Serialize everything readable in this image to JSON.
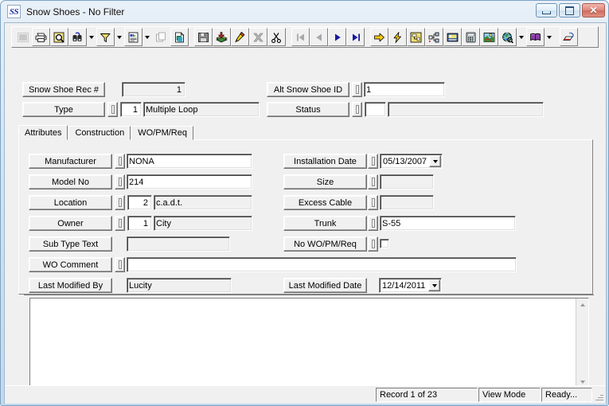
{
  "window": {
    "title": "Snow Shoes - No Filter",
    "app_icon_text": "SS",
    "minimize_label": "",
    "maximize_label": "",
    "close_label": "✕"
  },
  "toolbar": {
    "buttons": [
      {
        "name": "grid-view-icon",
        "title": "Grid"
      },
      {
        "name": "print-icon",
        "title": "Print"
      },
      {
        "name": "print-preview-icon",
        "title": "Print Preview"
      },
      {
        "name": "find-icon",
        "title": "Find"
      },
      {
        "name": "filter-icon",
        "title": "Filter"
      },
      {
        "name": "report-icon",
        "title": "Report"
      },
      {
        "name": "copy-record-icon",
        "title": "Copy Record"
      },
      {
        "name": "new-record-icon",
        "title": "New Record"
      },
      {
        "name": "save-icon",
        "title": "Save"
      },
      {
        "name": "add-icon",
        "title": "Add"
      },
      {
        "name": "edit-icon",
        "title": "Edit"
      },
      {
        "name": "delete-icon",
        "title": "Delete"
      },
      {
        "name": "cut-icon",
        "title": "Cut"
      },
      {
        "name": "first-record-icon",
        "title": "First Record"
      },
      {
        "name": "previous-record-icon",
        "title": "Previous Record"
      },
      {
        "name": "next-record-icon",
        "title": "Next Record"
      },
      {
        "name": "last-record-icon",
        "title": "Last Record"
      },
      {
        "name": "goto-icon",
        "title": "Go To"
      },
      {
        "name": "quick-action-icon",
        "title": "Quick Action"
      },
      {
        "name": "work-order-icon",
        "title": "Work Order"
      },
      {
        "name": "tree-view-icon",
        "title": "Tree View"
      },
      {
        "name": "inventory-icon",
        "title": "Inventory"
      },
      {
        "name": "calculator-icon",
        "title": "Calculator"
      },
      {
        "name": "map-icon",
        "title": "Map"
      },
      {
        "name": "gis-icon",
        "title": "GIS"
      },
      {
        "name": "documents-icon",
        "title": "Documents"
      },
      {
        "name": "tools-icon",
        "title": "Tools"
      }
    ]
  },
  "header": {
    "rec_label": "Snow Shoe Rec #",
    "rec_value": "1",
    "type_label": "Type",
    "type_code": "1",
    "type_text": "Multiple Loop",
    "alt_id_label": "Alt Snow Shoe ID",
    "alt_id_value": "1",
    "status_label": "Status",
    "status_code": "",
    "status_text": ""
  },
  "tabs": [
    {
      "label": "Attributes",
      "active": true
    },
    {
      "label": "Construction",
      "active": false
    },
    {
      "label": "WO/PM/Req",
      "active": false
    }
  ],
  "attributes": {
    "left": [
      {
        "label": "Manufacturer",
        "value": "NONA",
        "kind": "text"
      },
      {
        "label": "Model No",
        "value": "214",
        "kind": "text"
      },
      {
        "label": "Location",
        "code": "2",
        "value": "c.a.d.t.",
        "kind": "code"
      },
      {
        "label": "Owner",
        "code": "1",
        "value": "City",
        "kind": "code"
      },
      {
        "label": "Sub Type Text",
        "value": "",
        "kind": "readonly-nopin"
      }
    ],
    "right": [
      {
        "label": "Installation Date",
        "value": "05/13/2007",
        "kind": "date"
      },
      {
        "label": "Size",
        "value": "",
        "kind": "readonly"
      },
      {
        "label": "Excess Cable",
        "value": "",
        "kind": "readonly"
      },
      {
        "label": "Trunk",
        "value": "S-55",
        "kind": "text"
      },
      {
        "label": "No WO/PM/Req",
        "value": "",
        "kind": "checkbox",
        "checked": false
      }
    ],
    "wo_comment_label": "WO Comment",
    "wo_comment_value": "",
    "last_modified_by_label": "Last Modified By",
    "last_modified_by_value": "Lucity",
    "last_modified_date_label": "Last Modified Date",
    "last_modified_date_value": "12/14/2011"
  },
  "memo": {
    "value": ""
  },
  "statusbar": {
    "record": "Record 1 of 23",
    "mode": "View Mode",
    "state": "Ready..."
  },
  "colors": {
    "face": "#f0f0f0",
    "title_gradient_top": "#e8f0f8",
    "title_gradient_bottom": "#c3d9ec",
    "close_button": "#ce6b5c",
    "field_bg": "#ffffff",
    "readonly_bg": "#f0f0f0"
  }
}
